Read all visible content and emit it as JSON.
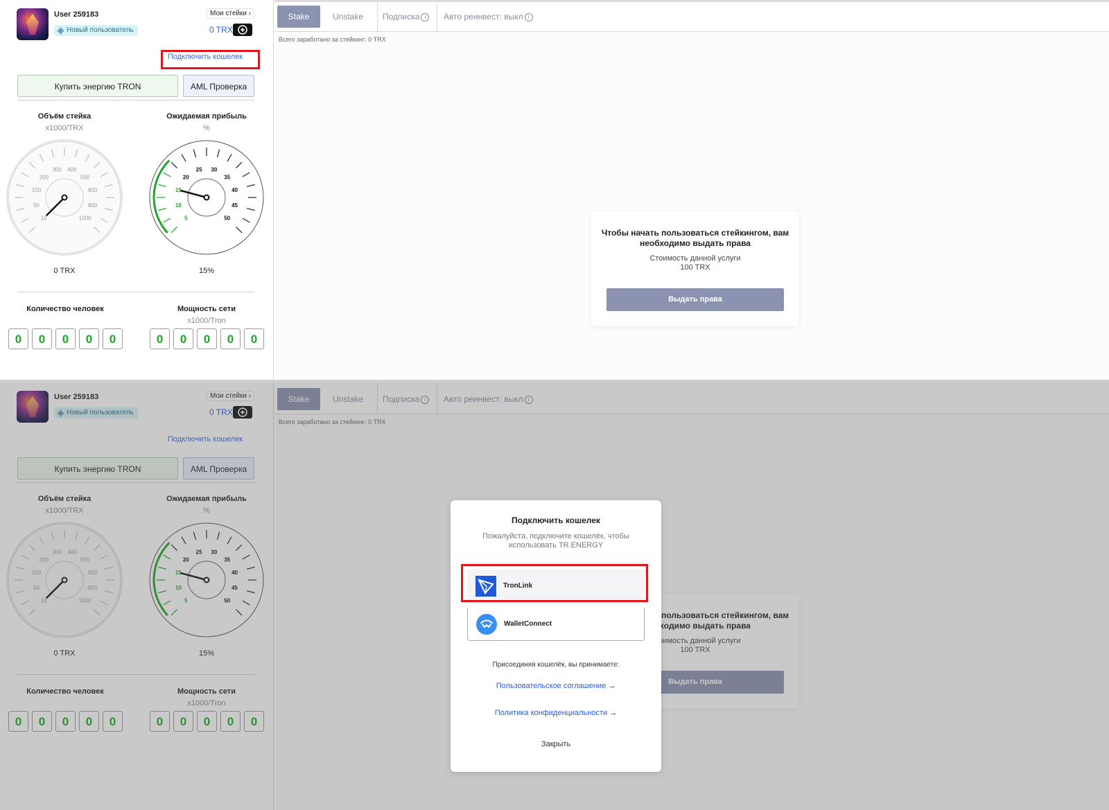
{
  "sidebar": {
    "username": "User 259183",
    "badge": "Новый пользователь",
    "my_stakes": "Мои стейки",
    "balance": "0 TRX",
    "connect_wallet": "Подключить кошелек",
    "buy_energy": "Купить энергию TRON",
    "aml_check": "AML Проверка",
    "gauge_volume": {
      "title": "Объём стейка",
      "unit": "x1000/TRX",
      "value_text": "0 TRX",
      "ticks": [
        "10",
        "50",
        "100",
        "200",
        "300",
        "400",
        "500",
        "600",
        "800",
        "1000"
      ],
      "needle_value": 0
    },
    "gauge_profit": {
      "title": "Ожидаемая прибыль",
      "unit": "%",
      "value_text": "15%",
      "ticks": [
        "5",
        "10",
        "15",
        "20",
        "25",
        "30",
        "35",
        "40",
        "45",
        "50"
      ],
      "needle_value": 15,
      "accent": "#1fa52a"
    },
    "people": {
      "title": "Количество человек",
      "digits": [
        "0",
        "0",
        "0",
        "0",
        "0"
      ]
    },
    "network": {
      "title": "Мощность сети",
      "unit": "x1000/Tron",
      "digits": [
        "0",
        "0",
        "0",
        "0",
        "0"
      ]
    }
  },
  "tabs": {
    "stake": "Stake",
    "unstake": "Unstake",
    "subscription": "Подписка",
    "auto_reinvest": "Авто реинвест: выкл",
    "info_glyph": "i"
  },
  "main": {
    "earned": "Всего заработано за стейкинг: 0 TRX",
    "card_title": "Чтобы начать пользоваться стейкингом, вам необходимо выдать права",
    "card_cost_label": "Стоимость данной услуги",
    "card_cost_value": "100 TRX",
    "card_button": "Выдать права"
  },
  "modal": {
    "title": "Подключить кошелек",
    "subtitle": "Пожалуйста, подключите кошелёк, чтобы использовать TR.ENERGY",
    "wallets": [
      "TronLink",
      "WalletConnect"
    ],
    "accept": "Присоединяя кошелёк, вы принимаете:",
    "terms": "Пользовательское соглашение",
    "privacy": "Политика конфиденциальности",
    "close": "Закрыть"
  },
  "colors": {
    "accent": "#8b93b1",
    "link": "#2a5bd7",
    "highlight": "#e0161c",
    "digit": "#1fa52a"
  }
}
